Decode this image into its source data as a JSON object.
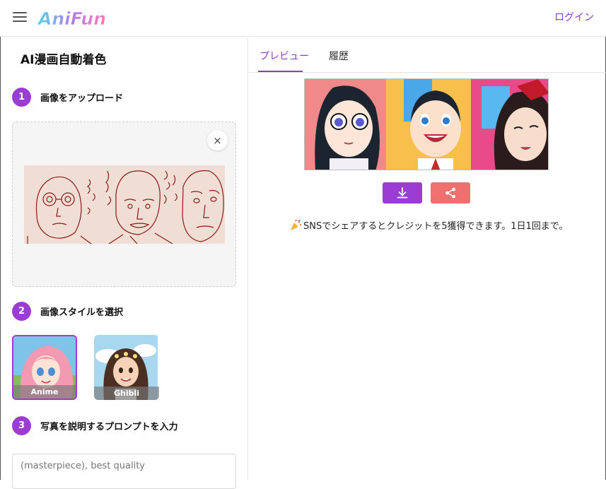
{
  "header": {
    "logo_text": "AniFun",
    "login_label": "ログイン"
  },
  "left_panel": {
    "title": "AI漫画自動着色",
    "steps": [
      {
        "num": "1",
        "label": "画像をアップロード"
      },
      {
        "num": "2",
        "label": "画像スタイルを選択"
      },
      {
        "num": "3",
        "label": "写真を説明するプロンプトを入力"
      }
    ],
    "close_symbol": "×",
    "styles": [
      {
        "name": "Anime",
        "selected": true
      },
      {
        "name": "Ghibli",
        "selected": false
      }
    ],
    "prompt": {
      "value": "(masterpiece), best quality"
    }
  },
  "right_panel": {
    "tabs": [
      {
        "label": "プレビュー",
        "active": true
      },
      {
        "label": "履歴",
        "active": false
      }
    ],
    "share_note": "SNSでシェアするとクレジットを5獲得できます。1日1回まで。"
  },
  "icons": {
    "menu": "hamburger-icon",
    "close": "close-icon",
    "download": "download-icon",
    "share": "share-icon",
    "party": "party-popper-icon"
  },
  "colors": {
    "accent": "#9b3dd4",
    "share_button": "#f07070",
    "link": "#8a3fc4"
  }
}
